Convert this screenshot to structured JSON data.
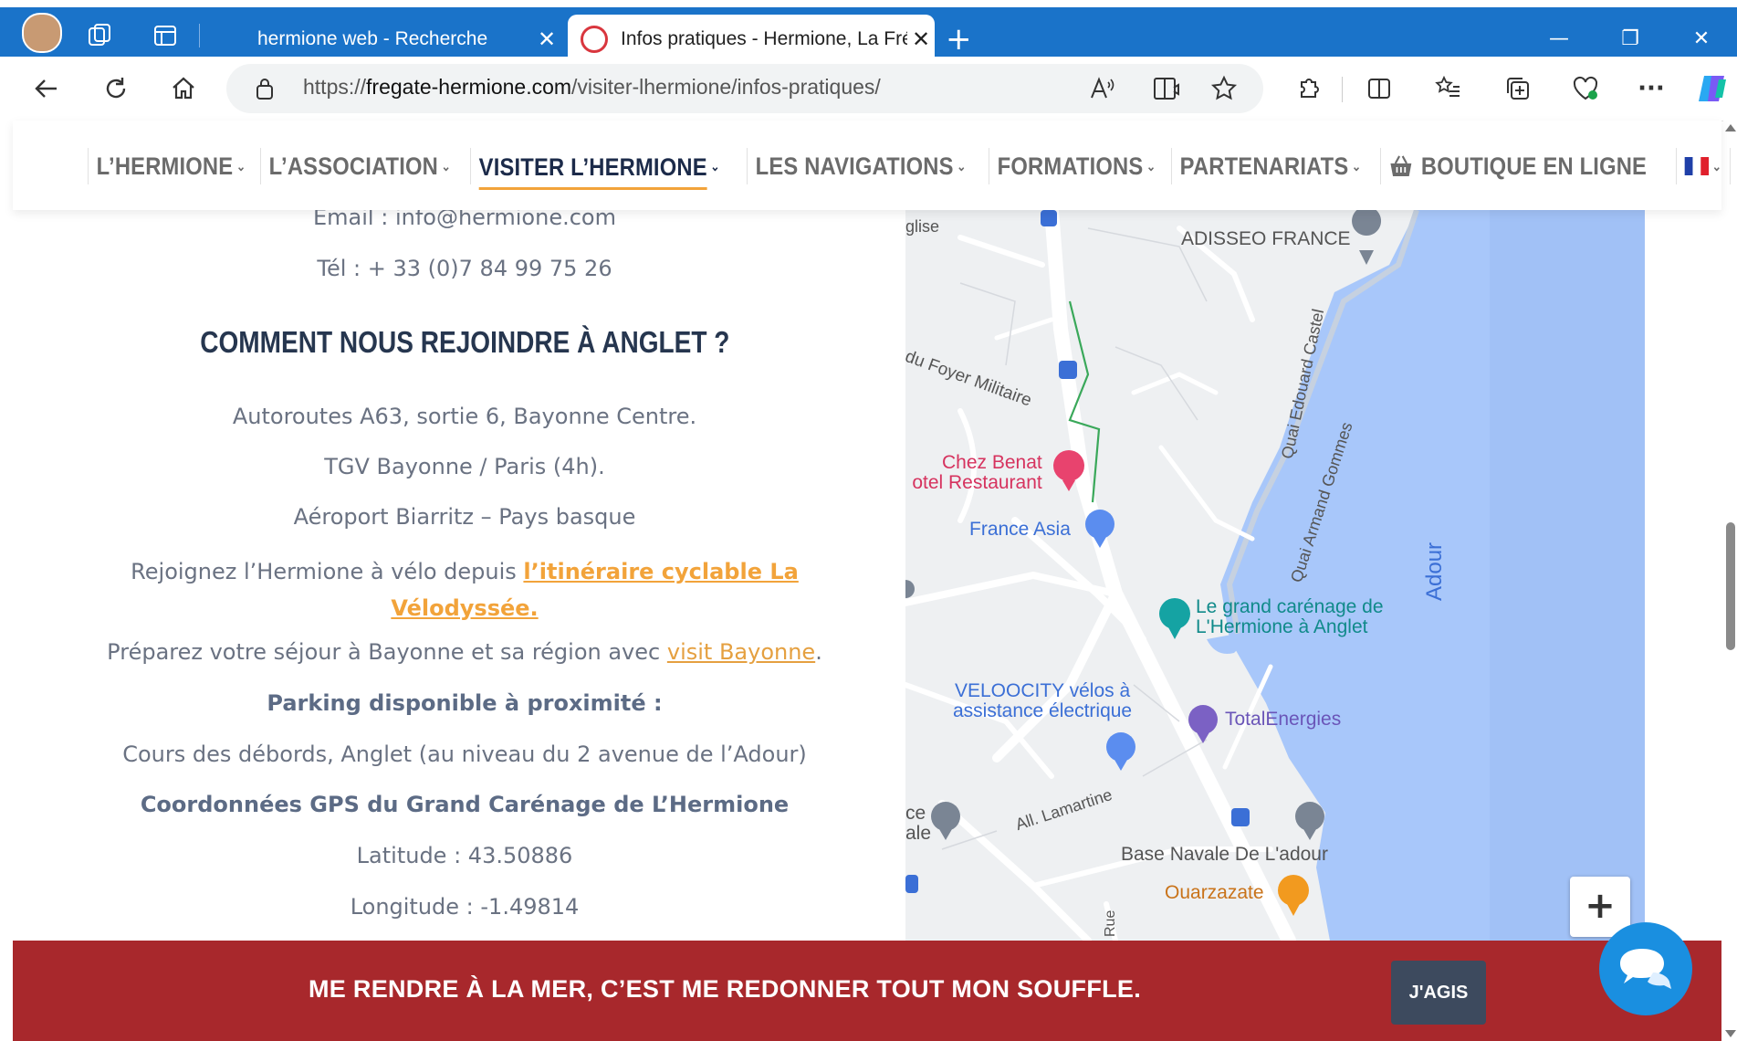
{
  "browser": {
    "tabs": [
      {
        "title": "hermione web - Recherche"
      },
      {
        "title": "Infos pratiques - Hermione, La Frégate"
      }
    ],
    "close_glyph": "✕",
    "new_tab_glyph": "+",
    "window_controls": {
      "minimize": "—",
      "restore": "❐",
      "close": "✕"
    },
    "url_prefix": "https://",
    "url_domain": "fregate-hermione.com",
    "url_path": "/visiter-lhermione/infos-pratiques/",
    "more_glyph": "···"
  },
  "site_menu": {
    "items": [
      {
        "label": "L’HERMIONE"
      },
      {
        "label": "L’ASSOCIATION"
      },
      {
        "label": "VISITER L’HERMIONE"
      },
      {
        "label": "LES NAVIGATIONS"
      },
      {
        "label": "FORMATIONS"
      },
      {
        "label": "PARTENARIATS"
      },
      {
        "label": "BOUTIQUE EN LIGNE"
      }
    ],
    "chevron": "⌄",
    "active_index": 2
  },
  "content": {
    "email": "Email : info@hermione.com",
    "phone": "Tél : + 33 (0)7 84 99 75 26",
    "heading": "COMMENT NOUS REJOINDRE À ANGLET ?",
    "road": "Autoroutes A63, sortie 6, Bayonne Centre.",
    "train": "TGV Bayonne / Paris (4h).",
    "airport": "Aéroport Biarritz – Pays basque",
    "bike_prefix": "Rejoignez l’Hermione à vélo depuis ",
    "bike_link_1": "l’itinéraire cyclable La",
    "bike_link_2": "Vélodyssée.",
    "stay_prefix": "Préparez votre séjour à Bayonne et sa région avec ",
    "stay_link": "visit Bayonne",
    "stay_suffix": ".",
    "parking_title": "Parking disponible à proximité :",
    "parking_text": "Cours des débords, Anglet (au niveau du 2 avenue de l’Adour)",
    "gps_title": "Coordonnées GPS du Grand Carénage de L’Hermione",
    "latitude": "Latitude : 43.50886",
    "longitude": "Longitude : -1.49814"
  },
  "map": {
    "labels": {
      "eglise": "glise",
      "adisseo": "ADISSEO FRANCE",
      "foyer": "du Foyer Militaire",
      "quai_castel": "Quai Edouard Castel",
      "quai_gommes": "Quai Armand Gommes",
      "chez_benat_1": "Chez Benat",
      "chez_benat_2": "otel Restaurant",
      "france_asia": "France Asia",
      "adour": "Adour",
      "carenage_1": "Le grand carénage de",
      "carenage_2": "L'Hermione à Anglet",
      "velocity_1": "VELOOCITY vélos à",
      "velocity_2": "assistance électrique",
      "total": "TotalEnergies",
      "ce": "ce",
      "ale": "ale",
      "lamartine": "All. Lamartine",
      "base_navale": "Base Navale De L'adour",
      "ouarzazate": "Ouarzazate",
      "rue": "Rue"
    },
    "zoom_in": "+",
    "colors": {
      "water": "#a8c7fa",
      "land": "#eef0f2",
      "road": "#ffffff",
      "poi_pink": "#e8436e",
      "poi_blue": "#5b8def",
      "poi_teal": "#15a3a3",
      "poi_purple": "#7b61c4",
      "poi_orange": "#f29a1f"
    }
  },
  "banner": {
    "text": "ME RENDRE À LA MER, C’EST ME REDONNER TOUT MON SOUFFLE.",
    "button": "J'AGIS",
    "color": "#a8282c"
  }
}
